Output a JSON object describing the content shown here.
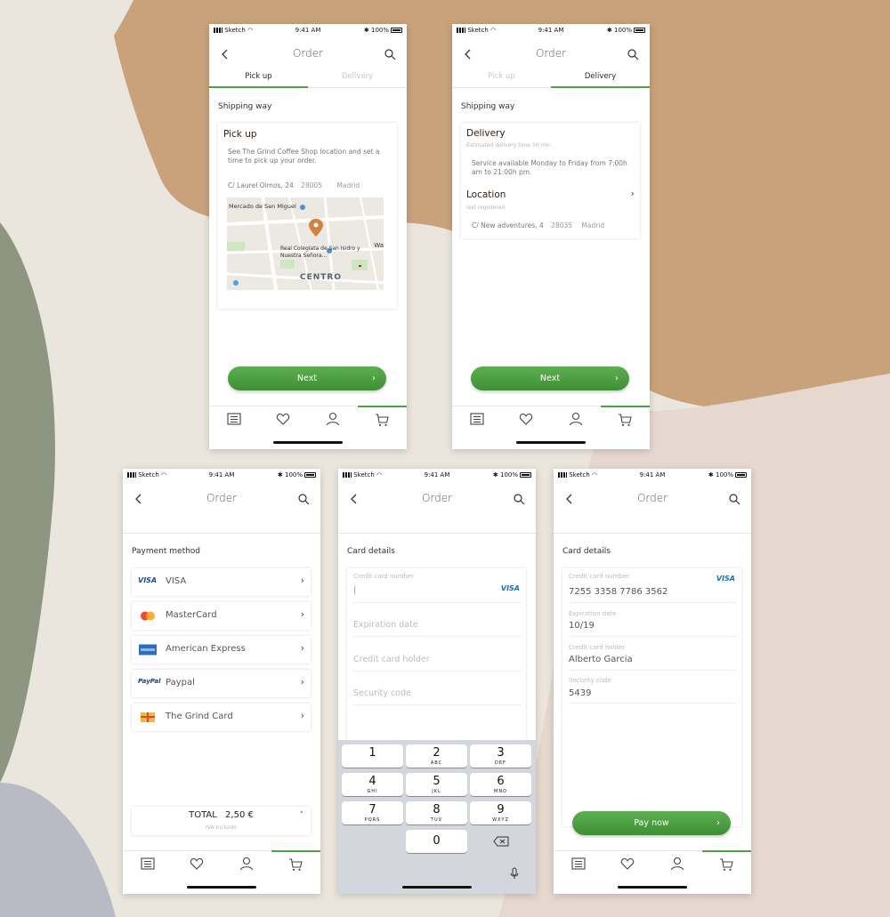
{
  "status": {
    "carrier": "Sketch",
    "time": "9:41 AM",
    "battery": "100%"
  },
  "screens": {
    "pickup": {
      "title": "Order",
      "tabs": [
        "Pick up",
        "Delivery"
      ],
      "section_title": "Shipping way",
      "card_title": "Pick up",
      "description": "See The Grind Coffee Shop location and set a time to pick up your order.",
      "address": {
        "street": "C/ Laurel Olmos, 24",
        "zip": "28005",
        "city": "Madrid"
      },
      "map_labels": {
        "market": "Mercado de San Miguel",
        "church": "Real Colegiata de San Isidro y Nuestra Señora...",
        "district": "CENTRO",
        "edge": "Wa"
      },
      "button": "Next"
    },
    "delivery": {
      "title": "Order",
      "tabs": [
        "Pick up",
        "Delivery"
      ],
      "section_title": "Shipping way",
      "card_title": "Delivery",
      "estimated": "Estimated delivery time  30 min.",
      "service": "Service available Monday to Friday from 7:00h am to 21:00h pm.",
      "location_title": "Location",
      "location_sub": "last registered",
      "address": {
        "street": "C/ New adventures, 4",
        "zip": "28035",
        "city": "Madrid"
      },
      "button": "Next"
    },
    "payment": {
      "title": "Order",
      "section_title": "Payment method",
      "methods": [
        {
          "label": "VISA",
          "logo": "visa-logo"
        },
        {
          "label": "MasterCard",
          "logo": "mastercard-logo"
        },
        {
          "label": "American Express",
          "logo": "amex-logo"
        },
        {
          "label": "Paypal",
          "logo": "paypal-logo"
        },
        {
          "label": "The Grind Card",
          "logo": "gift-card-logo"
        }
      ],
      "logo_text": {
        "visa": "VISA",
        "paypal": "PayPal"
      },
      "total_label": "TOTAL",
      "total_value": "2,50 €",
      "tax_note": "IVA Incluido"
    },
    "card_empty": {
      "title": "Order",
      "section_title": "Card details",
      "card_number_label": "Credit card number",
      "card_number_value": "|",
      "card_logo": "VISA",
      "expiration_placeholder": "Expiration date",
      "holder_placeholder": "Credit card holder",
      "security_placeholder": "Security code",
      "keys": [
        {
          "d": "1",
          "l": ""
        },
        {
          "d": "2",
          "l": "ABC"
        },
        {
          "d": "3",
          "l": "DEF"
        },
        {
          "d": "4",
          "l": "GHI"
        },
        {
          "d": "5",
          "l": "JKL"
        },
        {
          "d": "6",
          "l": "MNO"
        },
        {
          "d": "7",
          "l": "PQRS"
        },
        {
          "d": "8",
          "l": "TUV"
        },
        {
          "d": "9",
          "l": "WXYZ"
        },
        {
          "d": "0",
          "l": ""
        }
      ]
    },
    "card_filled": {
      "title": "Order",
      "section_title": "Card details",
      "card_logo": "VISA",
      "fields": [
        {
          "label": "Credit card number",
          "value": "7255 3358 7786 3562"
        },
        {
          "label": "Expiration date",
          "value": "10/19"
        },
        {
          "label": "Credit card holder",
          "value": "Alberto Garcia"
        },
        {
          "label": "Security code",
          "value": "5439"
        }
      ],
      "button": "Pay now"
    }
  },
  "colors": {
    "accent": "#4ea246",
    "text": "#3a2e28"
  }
}
